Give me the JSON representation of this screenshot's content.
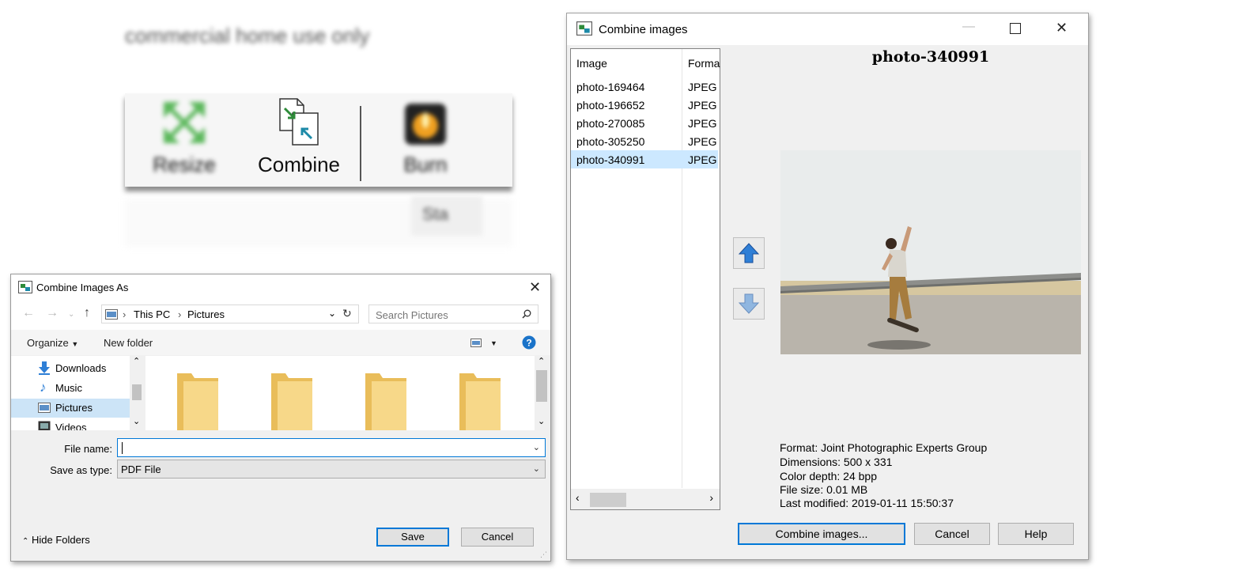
{
  "background": {
    "blurred_caption": "commercial home use only",
    "ribbon": {
      "resize_label": "Resize",
      "combine_label": "Combine",
      "burn_label": "Burn",
      "start_label": "Sta"
    }
  },
  "save_dialog": {
    "title": "Combine Images As",
    "breadcrumb": [
      "This PC",
      "Pictures"
    ],
    "search_placeholder": "Search Pictures",
    "organize_label": "Organize",
    "new_folder_label": "New folder",
    "help_glyph": "?",
    "nav_items": [
      {
        "label": "Downloads",
        "icon": "download-icon"
      },
      {
        "label": "Music",
        "icon": "music-icon"
      },
      {
        "label": "Pictures",
        "icon": "pictures-icon",
        "selected": true
      },
      {
        "label": "Videos",
        "icon": "videos-icon"
      }
    ],
    "file_name_label": "File name:",
    "file_name_value": "",
    "save_as_type_label": "Save as type:",
    "save_as_type_value": "PDF File",
    "hide_folders_label": "Hide Folders",
    "save_button": "Save",
    "cancel_button": "Cancel"
  },
  "combine_window": {
    "title": "Combine images",
    "columns": {
      "image": "Image",
      "format": "Forma"
    },
    "rows": [
      {
        "name": "photo-169464",
        "format": "JPEG"
      },
      {
        "name": "photo-196652",
        "format": "JPEG"
      },
      {
        "name": "photo-270085",
        "format": "JPEG"
      },
      {
        "name": "photo-305250",
        "format": "JPEG"
      },
      {
        "name": "photo-340991",
        "format": "JPEG",
        "selected": true
      }
    ],
    "preview_title": "photo-340991",
    "info": {
      "format": "Format: Joint Photographic Experts Group",
      "dimensions": "Dimensions: 500 x 331",
      "color_depth": "Color depth: 24 bpp",
      "file_size": "File size: 0.01 MB",
      "last_modified": "Last modified: 2019-01-11 15:50:37"
    },
    "combine_button": "Combine images...",
    "cancel_button": "Cancel",
    "help_button": "Help"
  },
  "colors": {
    "selection": "#cce8ff",
    "accent": "#0078d7",
    "folder": "#f5d27a"
  }
}
